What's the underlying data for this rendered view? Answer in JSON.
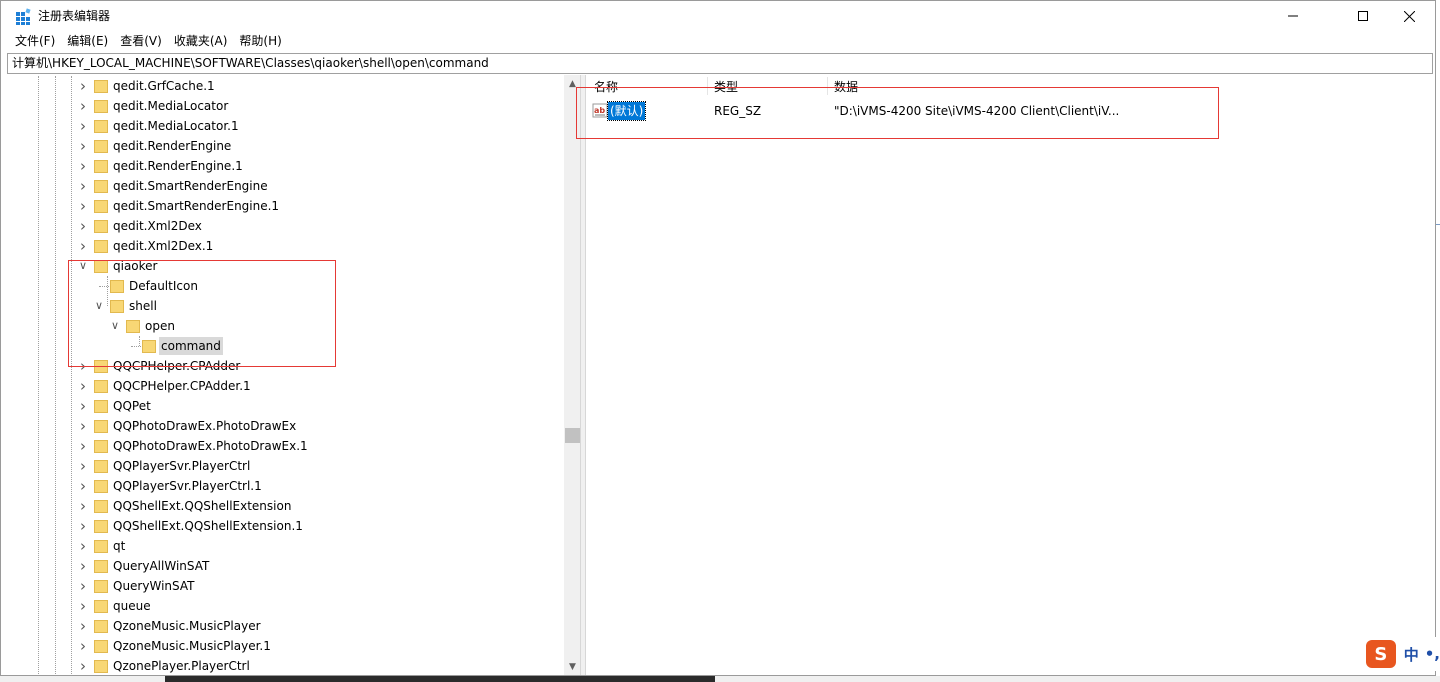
{
  "window": {
    "title": "注册表编辑器"
  },
  "menu": [
    "文件(F)",
    "编辑(E)",
    "查看(V)",
    "收藏夹(A)",
    "帮助(H)"
  ],
  "address": "计算机\\HKEY_LOCAL_MACHINE\\SOFTWARE\\Classes\\qiaoker\\shell\\open\\command",
  "tree": {
    "items": [
      {
        "label": "qedit.GrfCache.1",
        "level": 0,
        "expander": "collapsed"
      },
      {
        "label": "qedit.MediaLocator",
        "level": 0,
        "expander": "collapsed"
      },
      {
        "label": "qedit.MediaLocator.1",
        "level": 0,
        "expander": "collapsed"
      },
      {
        "label": "qedit.RenderEngine",
        "level": 0,
        "expander": "collapsed"
      },
      {
        "label": "qedit.RenderEngine.1",
        "level": 0,
        "expander": "collapsed"
      },
      {
        "label": "qedit.SmartRenderEngine",
        "level": 0,
        "expander": "collapsed"
      },
      {
        "label": "qedit.SmartRenderEngine.1",
        "level": 0,
        "expander": "collapsed"
      },
      {
        "label": "qedit.Xml2Dex",
        "level": 0,
        "expander": "collapsed"
      },
      {
        "label": "qedit.Xml2Dex.1",
        "level": 0,
        "expander": "collapsed"
      },
      {
        "label": "qiaoker",
        "level": 0,
        "expander": "expanded"
      },
      {
        "label": "DefaultIcon",
        "level": 1,
        "expander": "none"
      },
      {
        "label": "shell",
        "level": 1,
        "expander": "expanded"
      },
      {
        "label": "open",
        "level": 2,
        "expander": "expanded"
      },
      {
        "label": "command",
        "level": 3,
        "expander": "none",
        "selected": true
      },
      {
        "label": "QQCPHelper.CPAdder",
        "level": 0,
        "expander": "collapsed"
      },
      {
        "label": "QQCPHelper.CPAdder.1",
        "level": 0,
        "expander": "collapsed"
      },
      {
        "label": "QQPet",
        "level": 0,
        "expander": "collapsed"
      },
      {
        "label": "QQPhotoDrawEx.PhotoDrawEx",
        "level": 0,
        "expander": "collapsed"
      },
      {
        "label": "QQPhotoDrawEx.PhotoDrawEx.1",
        "level": 0,
        "expander": "collapsed"
      },
      {
        "label": "QQPlayerSvr.PlayerCtrl",
        "level": 0,
        "expander": "collapsed"
      },
      {
        "label": "QQPlayerSvr.PlayerCtrl.1",
        "level": 0,
        "expander": "collapsed"
      },
      {
        "label": "QQShellExt.QQShellExtension",
        "level": 0,
        "expander": "collapsed"
      },
      {
        "label": "QQShellExt.QQShellExtension.1",
        "level": 0,
        "expander": "collapsed"
      },
      {
        "label": "qt",
        "level": 0,
        "expander": "collapsed"
      },
      {
        "label": "QueryAllWinSAT",
        "level": 0,
        "expander": "collapsed"
      },
      {
        "label": "QueryWinSAT",
        "level": 0,
        "expander": "collapsed"
      },
      {
        "label": "queue",
        "level": 0,
        "expander": "collapsed"
      },
      {
        "label": "QzoneMusic.MusicPlayer",
        "level": 0,
        "expander": "collapsed"
      },
      {
        "label": "QzoneMusic.MusicPlayer.1",
        "level": 0,
        "expander": "collapsed"
      },
      {
        "label": "QzonePlayer.PlayerCtrl",
        "level": 0,
        "expander": "collapsed"
      }
    ]
  },
  "list": {
    "columns": {
      "name": "名称",
      "type": "类型",
      "data": "数据"
    },
    "rows": [
      {
        "name": "(默认)",
        "type": "REG_SZ",
        "data": "\"D:\\iVMS-4200 Site\\iVMS-4200 Client\\Client\\iV..."
      }
    ]
  },
  "ime": {
    "lang": "中",
    "punct": "•,"
  },
  "colors": {
    "selection": "#0078d7",
    "annotation": "#e53935",
    "folder": "#f8d775"
  }
}
